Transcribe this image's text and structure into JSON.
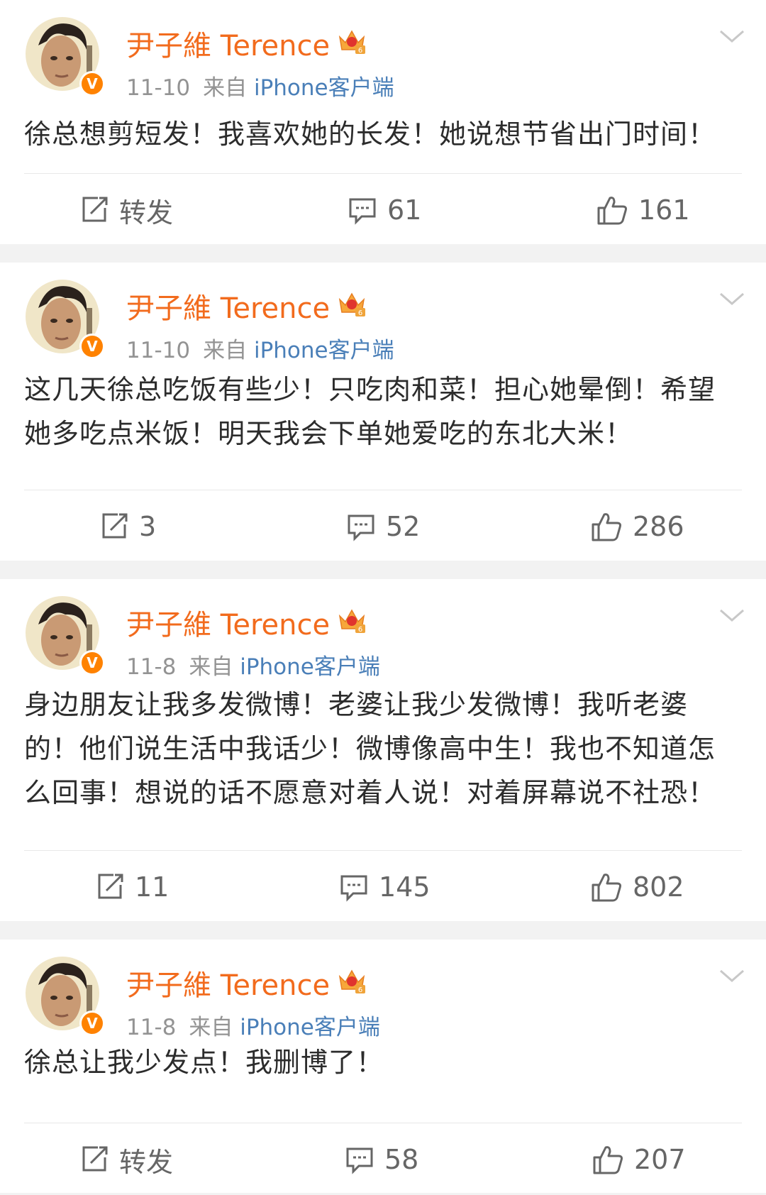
{
  "posts": [
    {
      "user": {
        "name": "尹子維 Terence",
        "verified_mark": "V",
        "crown_icon": "crown-level-icon"
      },
      "date": "11-10",
      "source_prefix": "来自",
      "device": "iPhone客户端",
      "text": "徐总想剪短发！我喜欢她的长发！她说想节省出门时间！",
      "repost": "转发",
      "comments": "61",
      "likes": "161"
    },
    {
      "user": {
        "name": "尹子維 Terence",
        "verified_mark": "V",
        "crown_icon": "crown-level-icon"
      },
      "date": "11-10",
      "source_prefix": "来自",
      "device": "iPhone客户端",
      "text": "这几天徐总吃饭有些少！只吃肉和菜！担心她晕倒！希望她多吃点米饭！明天我会下单她爱吃的东北大米！",
      "repost": "3",
      "comments": "52",
      "likes": "286"
    },
    {
      "user": {
        "name": "尹子維 Terence",
        "verified_mark": "V",
        "crown_icon": "crown-level-icon"
      },
      "date": "11-8",
      "source_prefix": "来自",
      "device": "iPhone客户端",
      "text": "身边朋友让我多发微博！老婆让我少发微博！我听老婆的！他们说生活中我话少！微博像高中生！我也不知道怎么回事！想说的话不愿意对着人说！对着屏幕说不社恐！",
      "repost": "11",
      "comments": "145",
      "likes": "802"
    },
    {
      "user": {
        "name": "尹子維 Terence",
        "verified_mark": "V",
        "crown_icon": "crown-level-icon"
      },
      "date": "11-8",
      "source_prefix": "来自",
      "device": "iPhone客户端",
      "text": "徐总让我少发点！我删博了！",
      "repost": "转发",
      "comments": "58",
      "likes": "207"
    }
  ],
  "colors": {
    "name": "#f26b1d",
    "device": "#4a7fb8",
    "verified": "#ff8200",
    "separator": "#f2f2f2"
  }
}
